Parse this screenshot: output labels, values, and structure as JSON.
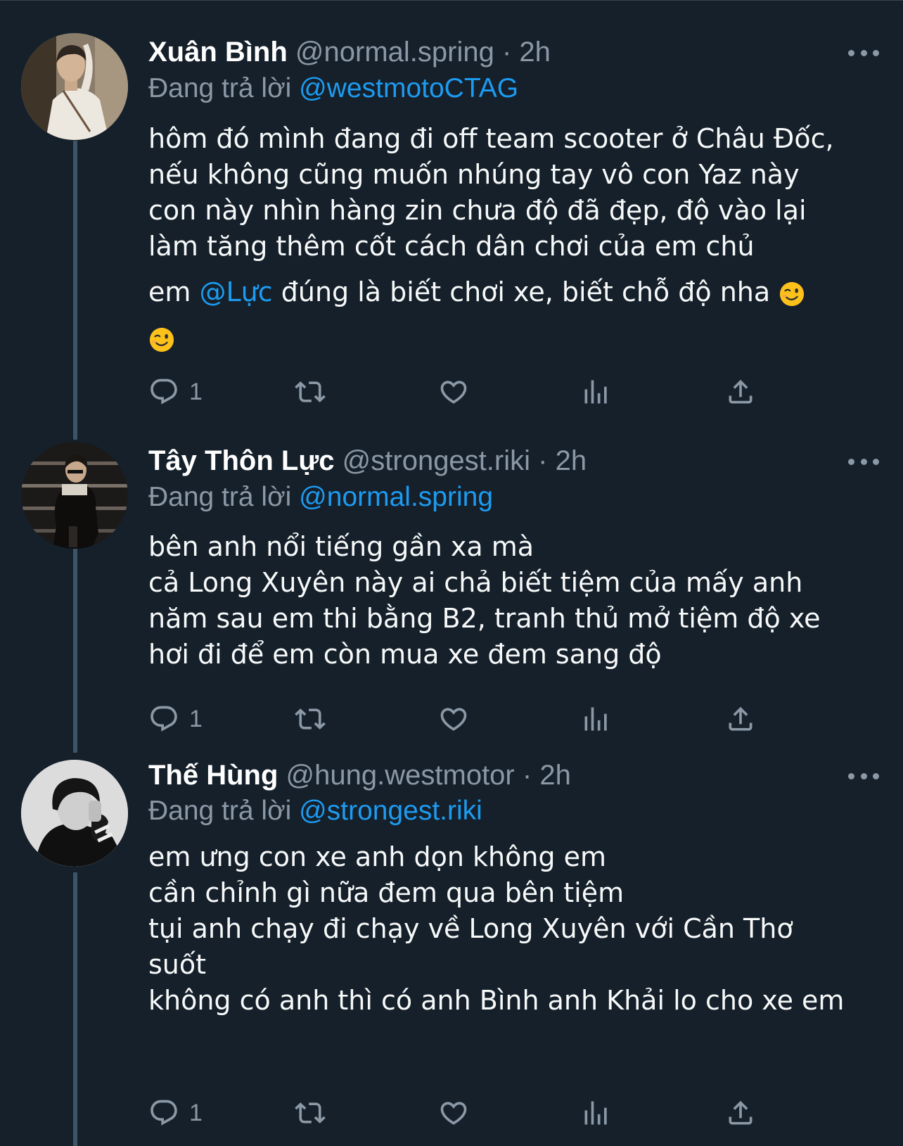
{
  "tweets": [
    {
      "name": "Xuân Bình",
      "handle": "@normal.spring",
      "separator": "·",
      "time": "2h",
      "replying_label": "Đang trả lời",
      "replying_to": "@westmotoCTAG",
      "body_lines": [
        "hôm đó mình đang đi off team scooter ở Châu Đốc,",
        "nếu không cũng muốn nhúng tay vô con Yaz này",
        "con này nhìn hàng zin chưa độ đã đẹp, độ vào lại",
        "làm tăng thêm cốt cách dân chơi của em chủ"
      ],
      "body_prefix": "em",
      "body_mention": "@Lực",
      "body_suffix": "đúng là biết chơi xe, biết chỗ độ nha",
      "reply_count": "1"
    },
    {
      "name": "Tây Thôn Lực",
      "handle": "@strongest.riki",
      "separator": "·",
      "time": "2h",
      "replying_label": "Đang trả lời",
      "replying_to": "@normal.spring",
      "body_lines": [
        "bên anh nổi tiếng gần xa mà",
        "cả Long Xuyên này ai chả biết tiệm của mấy anh",
        "năm sau em thi bằng B2, tranh thủ mở tiệm độ xe",
        "hơi đi để em còn mua xe đem sang độ"
      ],
      "reply_count": "1"
    },
    {
      "name": "Thế Hùng",
      "handle": "@hung.westmotor",
      "separator": "·",
      "time": "2h",
      "replying_label": "Đang trả lời",
      "replying_to": "@strongest.riki",
      "body_lines": [
        "em ưng con xe anh dọn không em",
        "cần chỉnh gì nữa đem qua bên tiệm",
        "tụi anh chạy đi chạy về Long Xuyên với Cần Thơ",
        "suốt",
        "không có anh thì có anh Bình anh Khải lo cho xe em"
      ],
      "reply_count": "1"
    }
  ],
  "icons": {
    "reply": "reply-icon",
    "retweet": "retweet-icon",
    "like": "heart-icon",
    "views": "analytics-icon",
    "share": "share-icon",
    "more": "more-options-icon",
    "emoji": "winking-face-emoji"
  },
  "colors": {
    "background": "#15202b",
    "text": "#f7f9f9",
    "secondary": "#8b98a5",
    "accent": "#1d9bf0",
    "thread_line": "#3d5466"
  }
}
